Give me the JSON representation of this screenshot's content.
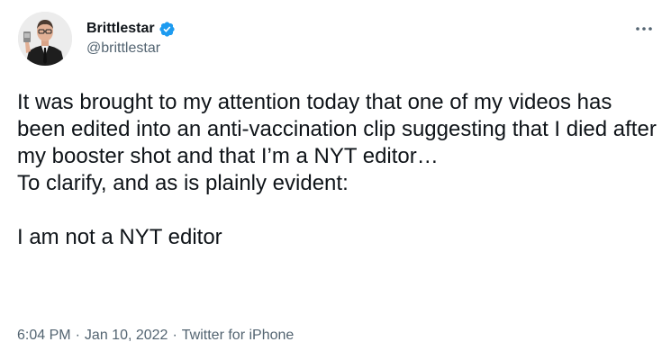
{
  "tweet": {
    "author": {
      "display_name": "Brittlestar",
      "handle": "@brittlestar",
      "verified": true
    },
    "text": "It was brought to my attention today that one of my videos has been edited into an anti-vaccination clip suggesting that I died after my booster shot and that I’m a NYT editor…\nTo clarify, and as is plainly evident:\n\nI am not a NYT editor",
    "time": "6:04 PM",
    "date": "Jan 10, 2022",
    "separator": "·",
    "source": "Twitter for iPhone"
  },
  "icons": {
    "verified": "verified-badge-icon",
    "more": "more-options-icon"
  },
  "colors": {
    "verified_blue": "#1d9bf0",
    "text_primary": "#0f1419",
    "text_secondary": "#536471"
  }
}
